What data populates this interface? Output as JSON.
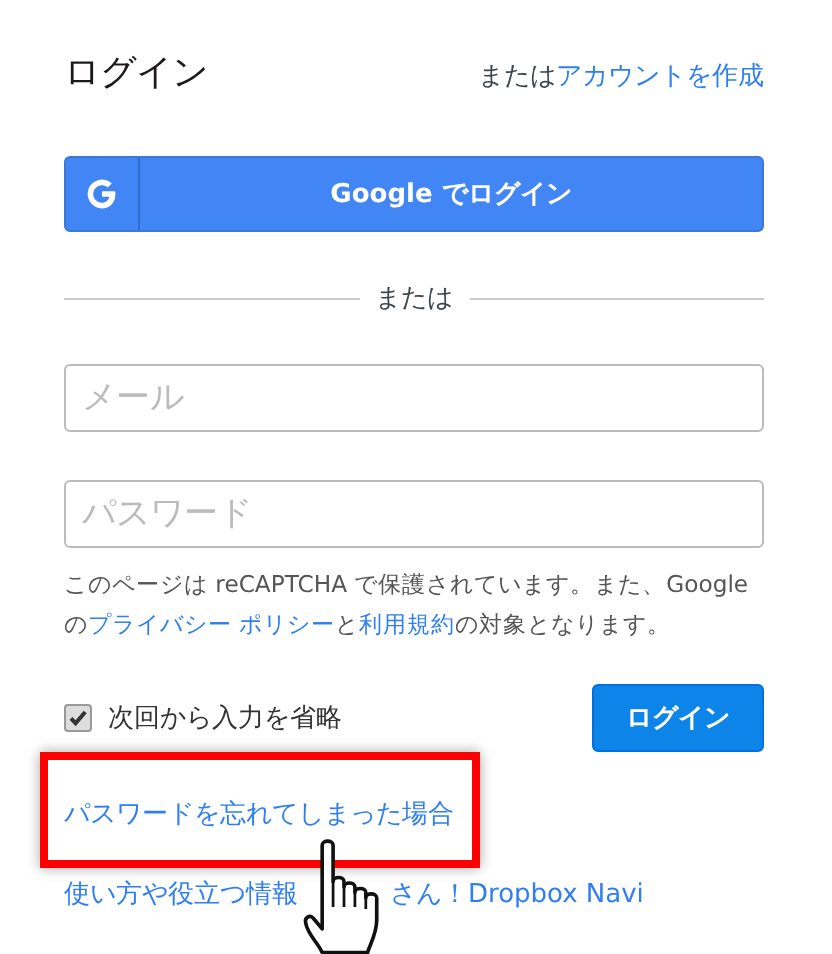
{
  "header": {
    "title": "ログイン",
    "prefix": "または",
    "signup_link": "アカウントを作成"
  },
  "google_button": {
    "label": "Google でログイン"
  },
  "divider_text": "または",
  "fields": [
    {
      "placeholder": "メール"
    },
    {
      "placeholder": "パスワード"
    }
  ],
  "notice": [
    {
      "text": "このページは reCAPTCHA で保護されています。また、Google の",
      "link": false
    },
    {
      "text": "プライバシー ポリシー",
      "link": true
    },
    {
      "text": "と",
      "link": false
    },
    {
      "text": "利用規約",
      "link": true
    },
    {
      "text": "の対象となります。",
      "link": false
    }
  ],
  "remember": {
    "label": "次回から入力を省略",
    "checked": true
  },
  "login_button": "ログイン",
  "forgot_link": {
    "label": "パスワードを忘れてしまった場合",
    "highlighted": true
  },
  "navi_link": {
    "parts": [
      "使い方や役立つ情報",
      "さん！Dropbox Navi"
    ]
  }
}
